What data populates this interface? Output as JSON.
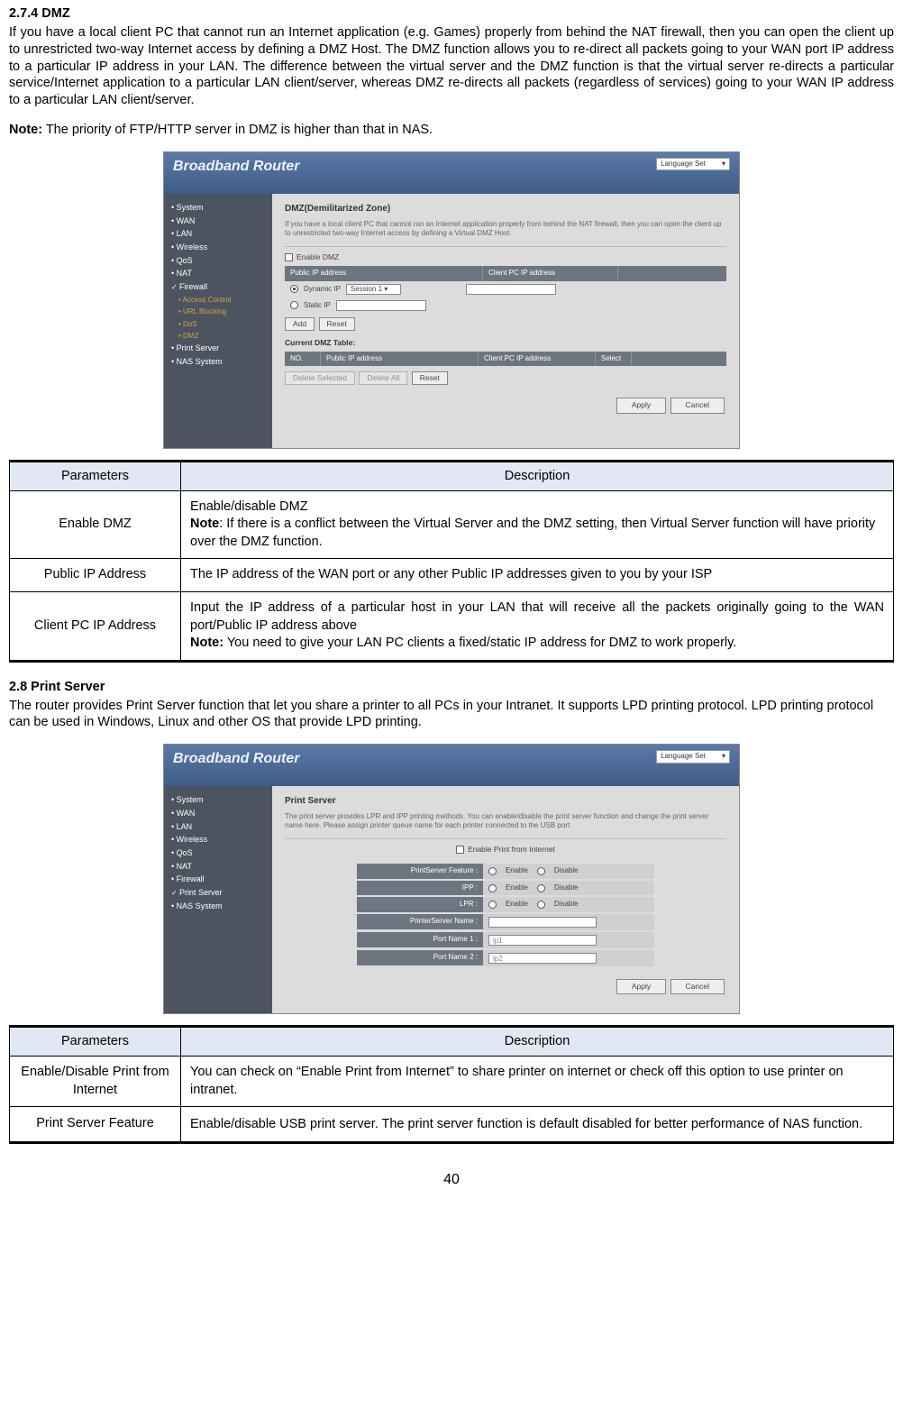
{
  "page_number": "40",
  "section_274": {
    "heading": "2.7.4 DMZ",
    "body": "If you have a local client PC that cannot run an Internet application (e.g. Games) properly from behind the NAT firewall, then you can open the client up to unrestricted two-way Internet access by defining a DMZ Host. The DMZ function allows you to re-direct all packets going to your WAN port IP address to a particular IP address in your LAN. The difference between the virtual server and the DMZ function is that the virtual server re-directs a particular service/Internet application to a particular LAN client/server, whereas DMZ re-directs all packets (regardless of services) going to your WAN IP address to a particular LAN client/server.",
    "note_label": "Note:",
    "note_text": " The priority of FTP/HTTP server in DMZ is higher than that in NAS."
  },
  "screenshot1": {
    "logo": "Broadband Router",
    "lang_label": "Language Set",
    "side": {
      "items": [
        "• System",
        "• WAN",
        "• LAN",
        "• Wireless",
        "• QoS",
        "• NAT"
      ],
      "firewall": "Firewall",
      "subs": [
        "• Access Control",
        "• URL Blocking",
        "• DoS",
        "• DMZ"
      ],
      "tail": [
        "• Print Server",
        "• NAS System"
      ]
    },
    "panel_title": "DMZ(Demilitarized Zone)",
    "desc": "If you have a local client PC that cannot run an Internet application properly from behind the NAT firewall, then you can open the client up to unrestricted two-way Internet access by defining a Virtual DMZ Host.",
    "enable_label": "Enable DMZ",
    "th_public": "Public IP address",
    "th_client": "Client PC IP address",
    "dyn_label": "Dynamic IP",
    "dyn_value": "Session 1",
    "static_label": "Static IP",
    "btn_add": "Add",
    "btn_reset": "Reset",
    "current_table": "Current DMZ Table:",
    "t2_no": "NO.",
    "t2_public": "Public IP address",
    "t2_client": "Client PC IP address",
    "t2_select": "Select",
    "btn_delsel": "Delete Selected",
    "btn_delall": "Delete All",
    "btn_apply": "Apply",
    "btn_cancel": "Cancel"
  },
  "table1": {
    "h_param": "Parameters",
    "h_desc": "Description",
    "rows": [
      {
        "param": "Enable DMZ",
        "desc_line1": "Enable/disable DMZ",
        "note_label": "Note",
        "desc_line2": ": If there is a conflict between the Virtual Server and the DMZ setting, then Virtual Server function will have priority over the DMZ function."
      },
      {
        "param": "Public IP Address",
        "desc": "The IP address of the WAN port or any other Public IP addresses given to you by your ISP"
      },
      {
        "param": "Client PC IP Address",
        "desc_line1": "Input the IP address of a particular host in your LAN that will receive all the packets originally going to the WAN port/Public IP address above",
        "note_label": "Note:",
        "desc_line2": " You need to give your LAN PC clients a fixed/static IP address for DMZ to work properly."
      }
    ]
  },
  "section_28": {
    "heading": "2.8 Print Server",
    "body": "The router provides Print Server function that let you share a printer to all PCs in your Intranet. It supports LPD printing protocol. LPD printing protocol can be used in Windows, Linux and other OS that provide LPD printing."
  },
  "screenshot2": {
    "logo": "Broadband Router",
    "lang_label": "Language Set",
    "side": [
      "• System",
      "• WAN",
      "• LAN",
      "• Wireless",
      "• QoS",
      "• NAT",
      "• Firewall"
    ],
    "side_sel": "Print Server",
    "side_tail": "• NAS System",
    "panel_title": "Print Server",
    "desc": "The print server provides LPR and IPP printing methods. You can enable/disable the print server function and change the print server name here. Please assign printer queue name for each printer connected to the USB port.",
    "enable_internet": "Enable Print from Internet",
    "rows": {
      "feature": "PrintServer Feature :",
      "ipp": "IPP :",
      "lpr": "LPR :",
      "psname": "PrinterServer Name :",
      "port1": "Port Name 1 :",
      "port2": "Port Name 2 :"
    },
    "opt_enable": "Enable",
    "opt_disable": "Disable",
    "port1_val": "lp1",
    "port2_val": "lp2",
    "btn_apply": "Apply",
    "btn_cancel": "Cancel"
  },
  "table2": {
    "h_param": "Parameters",
    "h_desc": "Description",
    "rows": [
      {
        "param": "Enable/Disable Print from Internet",
        "desc": "You can check on “Enable Print from Internet” to share printer on internet or check off this option to use printer on intranet."
      },
      {
        "param": "Print Server Feature",
        "desc_a": "Enable/disable USB print server. The print server function is default ",
        "desc_d": "d",
        "desc_b": "isabled for better performance of NAS function."
      }
    ]
  }
}
